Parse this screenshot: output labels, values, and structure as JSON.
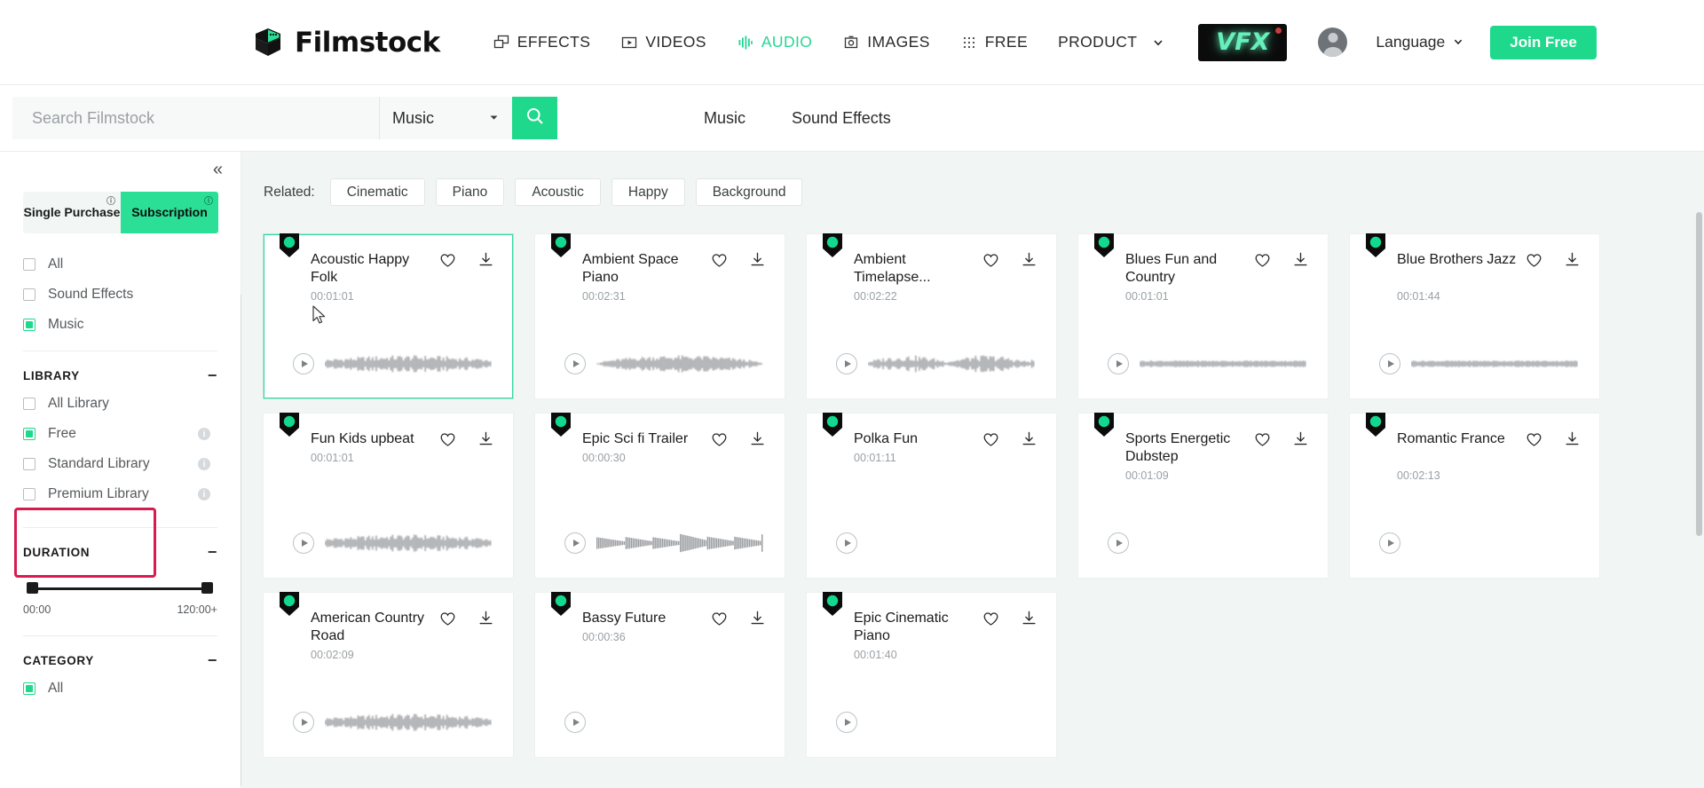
{
  "brand": {
    "name": "Filmstock",
    "logo_icon": "filmstock-cube-logo"
  },
  "topnav": {
    "items": [
      {
        "label": "EFFECTS",
        "icon": "layers-icon",
        "active": false
      },
      {
        "label": "VIDEOS",
        "icon": "video-play-icon",
        "active": false
      },
      {
        "label": "AUDIO",
        "icon": "audio-waveform-icon",
        "active": true
      },
      {
        "label": "IMAGES",
        "icon": "camera-icon",
        "active": false
      },
      {
        "label": "FREE",
        "icon": "grid-dots-icon",
        "active": false
      },
      {
        "label": "PRODUCT",
        "icon": "chevron-down-icon",
        "active": false
      }
    ],
    "vfx_label": "VFX",
    "language_label": "Language",
    "language_caret": "▾",
    "join_free_label": "Join Free",
    "accent_green": "#1ED98C",
    "active_green": "#25D695"
  },
  "search": {
    "placeholder": "Search Filmstock",
    "value": "",
    "category_value": "Music",
    "category_caret": "▾",
    "search_icon": "magnifier-icon"
  },
  "secondary_tabs": [
    {
      "label": "Music"
    },
    {
      "label": "Sound Effects"
    }
  ],
  "sidebar": {
    "collapse_icon": "«",
    "purchase_toggle": {
      "single": "Single Purchase",
      "subscription": "Subscription",
      "selected": "Subscription",
      "info_icon": "info-circle-icon"
    },
    "type_filters": [
      {
        "label": "All",
        "checked": false
      },
      {
        "label": "Sound Effects",
        "checked": false
      },
      {
        "label": "Music",
        "checked": true
      }
    ],
    "library": {
      "title": "LIBRARY",
      "collapse": "−",
      "items": [
        {
          "label": "All Library",
          "checked": false,
          "info": false
        },
        {
          "label": "Free",
          "checked": true,
          "info": true
        },
        {
          "label": "Standard Library",
          "checked": false,
          "info": true
        },
        {
          "label": "Premium Library",
          "checked": false,
          "info": true
        }
      ]
    },
    "duration": {
      "title": "DURATION",
      "collapse": "−",
      "min_label": "00:00",
      "max_label": "120:00+"
    },
    "category": {
      "title": "CATEGORY",
      "collapse": "−",
      "items": [
        {
          "label": "All",
          "checked": true
        }
      ]
    },
    "highlight_color": "#D81B4E"
  },
  "content": {
    "related_label": "Related:",
    "related_tags": [
      "Cinematic",
      "Piano",
      "Acoustic",
      "Happy",
      "Background"
    ],
    "cards": [
      {
        "title": "Acoustic Happy Folk",
        "duration": "00:01:01",
        "selected": true,
        "badge": "free-badge",
        "wave": "dense",
        "two_line": true
      },
      {
        "title": "Ambient Space Piano",
        "duration": "00:02:31",
        "selected": false,
        "badge": "free-badge",
        "wave": "bulge",
        "two_line": true
      },
      {
        "title": "Ambient Timelapse...",
        "duration": "00:02:22",
        "selected": false,
        "badge": "free-badge",
        "wave": "spread",
        "two_line": true
      },
      {
        "title": "Blues Fun and Country",
        "duration": "00:01:01",
        "selected": false,
        "badge": "free-badge",
        "wave": "flat",
        "two_line": true
      },
      {
        "title": "Blue Brothers Jazz",
        "duration": "00:01:44",
        "selected": false,
        "badge": "free-badge",
        "wave": "flat",
        "two_line": true
      },
      {
        "title": "Fun Kids upbeat",
        "duration": "00:01:01",
        "selected": false,
        "badge": "free-badge",
        "wave": "dense",
        "two_line": false
      },
      {
        "title": "Epic Sci fi Trailer",
        "duration": "00:00:30",
        "selected": false,
        "badge": "free-badge",
        "wave": "peaks",
        "two_line": false
      },
      {
        "title": "Polka Fun",
        "duration": "00:01:11",
        "selected": false,
        "badge": "free-badge",
        "wave": "none",
        "two_line": false
      },
      {
        "title": "Sports Energetic Dubstep",
        "duration": "00:01:09",
        "selected": false,
        "badge": "free-badge",
        "wave": "none",
        "two_line": true
      },
      {
        "title": "Romantic France",
        "duration": "00:02:13",
        "selected": false,
        "badge": "free-badge",
        "wave": "none",
        "two_line": true
      },
      {
        "title": "American Country Road",
        "duration": "00:02:09",
        "selected": false,
        "badge": "free-badge",
        "wave": "dense",
        "two_line": true
      },
      {
        "title": "Bassy Future",
        "duration": "00:00:36",
        "selected": false,
        "badge": "free-badge",
        "wave": "none",
        "two_line": false
      },
      {
        "title": "Epic Cinematic Piano",
        "duration": "00:01:40",
        "selected": false,
        "badge": "free-badge",
        "wave": "none",
        "two_line": true
      }
    ],
    "heart_icon": "heart-outline-icon",
    "download_icon": "download-icon",
    "play_icon": "play-icon"
  }
}
